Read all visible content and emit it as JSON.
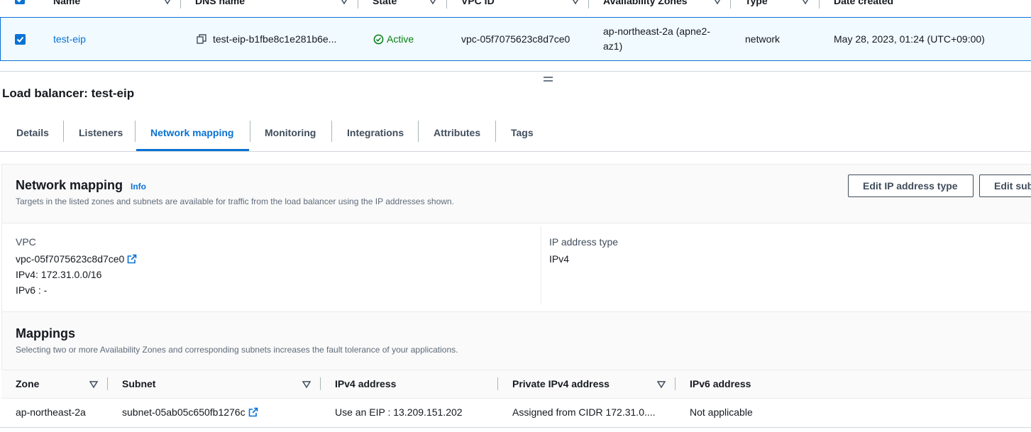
{
  "top_table": {
    "headers": [
      "Name",
      "DNS name",
      "State",
      "VPC ID",
      "Availability Zones",
      "Type",
      "Date created"
    ],
    "row": {
      "name": "test-eip",
      "dns_name": "test-eip-b1fbe8c1e281b6e...",
      "state": "Active",
      "vpc_id": "vpc-05f7075623c8d7ce0",
      "az_line1": "ap-northeast-2a (apne2-",
      "az_line2": "az1)",
      "type": "network",
      "date_created": "May 28, 2023, 01:24 (UTC+09:00)"
    }
  },
  "page_title": "Load balancer: test-eip",
  "tabs": [
    "Details",
    "Listeners",
    "Network mapping",
    "Monitoring",
    "Integrations",
    "Attributes",
    "Tags"
  ],
  "active_tab": "Network mapping",
  "network_mapping": {
    "title": "Network mapping",
    "info": "Info",
    "description": "Targets in the listed zones and subnets are available for traffic from the load balancer using the IP addresses shown.",
    "edit_ip_button": "Edit IP address type",
    "edit_subnets_button": "Edit subnets",
    "vpc_label": "VPC",
    "vpc_link": "vpc-05f7075623c8d7ce0",
    "ipv4": "IPv4: 172.31.0.0/16",
    "ipv6": "IPv6 : -",
    "ip_type_label": "IP address type",
    "ip_type_value": "IPv4"
  },
  "mappings": {
    "title": "Mappings",
    "description": "Selecting two or more Availability Zones and corresponding subnets increases the fault tolerance of your applications.",
    "headers": [
      "Zone",
      "Subnet",
      "IPv4 address",
      "Private IPv4 address",
      "IPv6 address"
    ],
    "row": {
      "zone": "ap-northeast-2a",
      "subnet": "subnet-05ab05c650fb1276c",
      "ipv4": "Use an EIP : 13.209.151.202",
      "private_ipv4": "Assigned from CIDR 172.31.0....",
      "ipv6": "Not applicable"
    }
  },
  "colors": {
    "link": "#0972d3",
    "success": "#037f0c",
    "selected_row_bg": "#f1faff",
    "text": "#16191f"
  }
}
